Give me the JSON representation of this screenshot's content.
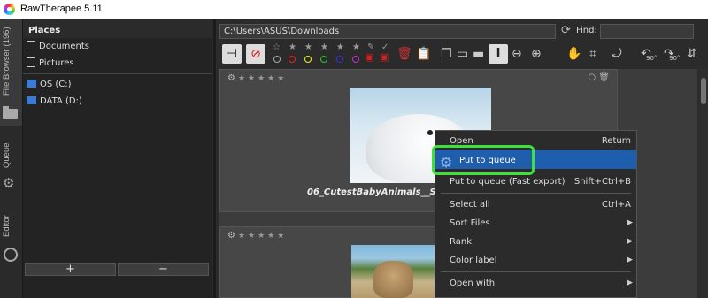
{
  "window": {
    "title": "RawTherapee 5.11"
  },
  "vertical_tabs": [
    {
      "label": "File Browser (196)"
    },
    {
      "label": "Queue"
    },
    {
      "label": "Editor"
    }
  ],
  "places": {
    "header": "Places",
    "items": [
      "Documents",
      "Pictures"
    ],
    "drives": [
      "OS (C:)",
      "DATA (D:)"
    ],
    "add_label": "+",
    "remove_label": "−"
  },
  "pathbar": {
    "path": "C:\\Users\\ASUS\\Downloads",
    "find_label": "Find:",
    "find_value": ""
  },
  "thumbnails": [
    {
      "name": "06_CutestBabyAnimals__Seals_s"
    },
    {
      "name": ""
    }
  ],
  "context_menu": {
    "items": [
      {
        "label": "Open",
        "shortcut": "Return"
      },
      {
        "label": "Put to queue",
        "shortcut": ""
      },
      {
        "label": "Put to queue (Fast export)",
        "shortcut": "Shift+Ctrl+B"
      },
      {
        "label": "Select all",
        "shortcut": "Ctrl+A"
      },
      {
        "label": "Sort Files",
        "shortcut": ""
      },
      {
        "label": "Rank",
        "shortcut": ""
      },
      {
        "label": "Color label",
        "shortcut": ""
      },
      {
        "label": "Open with",
        "shortcut": ""
      }
    ],
    "highlight_color": "#1f5eac",
    "annotation_color": "#3de03d"
  },
  "toolbar": {
    "rotate_left_label": "90°",
    "rotate_right_label": "90°"
  }
}
